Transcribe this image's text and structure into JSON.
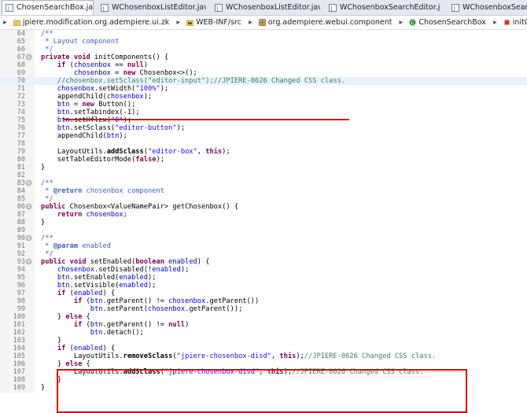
{
  "tabs": [
    {
      "label": "ChosenSearchBox.java",
      "active": true,
      "close": "✕"
    },
    {
      "label": "WChosenboxListEditor.jav",
      "active": false
    },
    {
      "label": "WChosenboxListEditor.jav",
      "active": false
    },
    {
      "label": "WChosenboxSearchEditor.j",
      "active": false
    },
    {
      "label": "WChosenboxSearch",
      "active": false
    }
  ],
  "breadcrumb": [
    "jpiere.modification.org.adempiere.ui.zk",
    "WEB-INF/src",
    "org.adempiere.webui.component",
    "ChosenSearchBox",
    "initComponents() : void"
  ],
  "lines": [
    {
      "n": "64",
      "fold": "",
      "text": "/**"
    },
    {
      "n": "65",
      "fold": "",
      "text": " * Layout component"
    },
    {
      "n": "66",
      "fold": "",
      "text": " */"
    },
    {
      "n": "67",
      "fold": "-",
      "text": "private void initComponents() {"
    },
    {
      "n": "68",
      "fold": "",
      "text": "    if (chosenbox == null)"
    },
    {
      "n": "69",
      "fold": "",
      "text": "        chosenbox = new Chosenbox<>();"
    },
    {
      "n": "70",
      "fold": "",
      "text": "    //chosenbox.setSclass(\"editor-input\");//JPIERE-0626 Changed CSS class."
    },
    {
      "n": "71",
      "fold": "",
      "text": "    chosenbox.setWidth(\"100%\");"
    },
    {
      "n": "72",
      "fold": "",
      "text": "    appendChild(chosenbox);"
    },
    {
      "n": "73",
      "fold": "",
      "text": "    btn = new Button();"
    },
    {
      "n": "74",
      "fold": "",
      "text": "    btn.setTabindex(-1);"
    },
    {
      "n": "75",
      "fold": "",
      "text": "    btn.setHflex(\"0\");"
    },
    {
      "n": "76",
      "fold": "",
      "text": "    btn.setSclass(\"editor-button\");"
    },
    {
      "n": "77",
      "fold": "",
      "text": "    appendChild(btn);"
    },
    {
      "n": "78",
      "fold": "",
      "text": ""
    },
    {
      "n": "79",
      "fold": "",
      "text": "    LayoutUtils.addSclass(\"editor-box\", this);"
    },
    {
      "n": "80",
      "fold": "",
      "text": "    setTableEditorMode(false);"
    },
    {
      "n": "81",
      "fold": "",
      "text": "}"
    },
    {
      "n": "82",
      "fold": "",
      "text": ""
    },
    {
      "n": "83",
      "fold": "-",
      "text": "/**"
    },
    {
      "n": "84",
      "fold": "",
      "text": " * @return chosenbox component"
    },
    {
      "n": "85",
      "fold": "",
      "text": " */"
    },
    {
      "n": "86",
      "fold": "-",
      "text": "public Chosenbox<ValueNamePair> getChosenbox() {"
    },
    {
      "n": "87",
      "fold": "",
      "text": "    return chosenbox;"
    },
    {
      "n": "88",
      "fold": "",
      "text": "}"
    },
    {
      "n": "89",
      "fold": "",
      "text": ""
    },
    {
      "n": "90",
      "fold": "-",
      "text": "/**"
    },
    {
      "n": "91",
      "fold": "",
      "text": " * @param enabled"
    },
    {
      "n": "92",
      "fold": "",
      "text": " */"
    },
    {
      "n": "93",
      "fold": "-",
      "text": "public void setEnabled(boolean enabled) {"
    },
    {
      "n": "94",
      "fold": "",
      "text": "    chosenbox.setDisabled(!enabled);"
    },
    {
      "n": "95",
      "fold": "",
      "text": "    btn.setEnabled(enabled);"
    },
    {
      "n": "96",
      "fold": "",
      "text": "    btn.setVisible(enabled);"
    },
    {
      "n": "97",
      "fold": "",
      "text": "    if (enabled) {"
    },
    {
      "n": "98",
      "fold": "",
      "text": "        if (btn.getParent() != chosenbox.getParent())"
    },
    {
      "n": "99",
      "fold": "",
      "text": "            btn.setParent(chosenbox.getParent());"
    },
    {
      "n": "100",
      "fold": "",
      "text": "    } else {"
    },
    {
      "n": "101",
      "fold": "",
      "text": "        if (btn.getParent() != null)"
    },
    {
      "n": "102",
      "fold": "",
      "text": "            btn.detach();"
    },
    {
      "n": "103",
      "fold": "",
      "text": "    }"
    },
    {
      "n": "104",
      "fold": "",
      "text": "    if (enabled) {"
    },
    {
      "n": "105",
      "fold": "",
      "text": "        LayoutUtils.removeSclass(\"jpiere-chosenbox-disd\", this);//JPIERE-0626 Changed CSS class."
    },
    {
      "n": "106",
      "fold": "",
      "text": "    } else {"
    },
    {
      "n": "107",
      "fold": "",
      "text": "        LayoutUtils.addSclass(\"jpiere-chosenbox-disd\", this);//JPIERE-0626 Changed CSS class."
    },
    {
      "n": "108",
      "fold": "",
      "text": "    }"
    },
    {
      "n": "109",
      "fold": "",
      "text": "}"
    }
  ],
  "colors": {
    "keyword": "#7f0055",
    "comment": "#3f7f5f",
    "javadoc": "#3f5fbf",
    "string": "#2a00ff",
    "field": "#0000c0",
    "highlight": "#e00000"
  }
}
